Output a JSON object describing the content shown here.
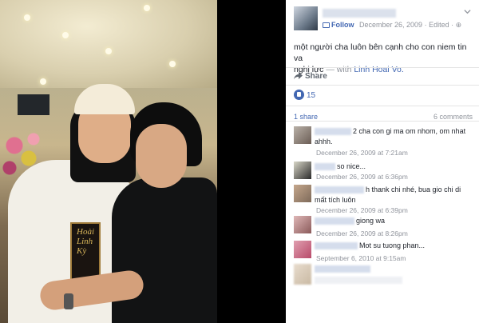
{
  "post": {
    "follow_label": "Follow",
    "date": "December 26, 2009",
    "edited_label": "Edited",
    "text_line1": "một người cha luôn bên cạnh cho con niem tin va",
    "text_line2": "nghị lực",
    "with_label": "— with",
    "tagged_name": "Linh Hoai Vo.",
    "photo_caption": "Hoài Linh Kỳ"
  },
  "actions": {
    "share_label": "Share"
  },
  "reactions": {
    "like_count": "15",
    "shares": "1 share",
    "comments": "6 comments"
  },
  "comments": [
    {
      "text": "2 cha con gi ma om nhom, om nhat ahhh.",
      "time": "December 26, 2009 at 7:21am"
    },
    {
      "text": "so nice...",
      "time": "December 26, 2009 at 6:36pm"
    },
    {
      "text": "h thank chi nhé, bua gio chi di mất tích luôn",
      "time": "December 26, 2009 at 6:39pm"
    },
    {
      "text": "giong wa",
      "time": "December 26, 2009 at 8:26pm"
    },
    {
      "text": "Mot su tuong phan...",
      "time": "September 6, 2010 at 9:15am"
    }
  ],
  "colors": {
    "link_blue": "#4267b2",
    "meta_gray": "#90949c",
    "text": "#1d2129"
  }
}
